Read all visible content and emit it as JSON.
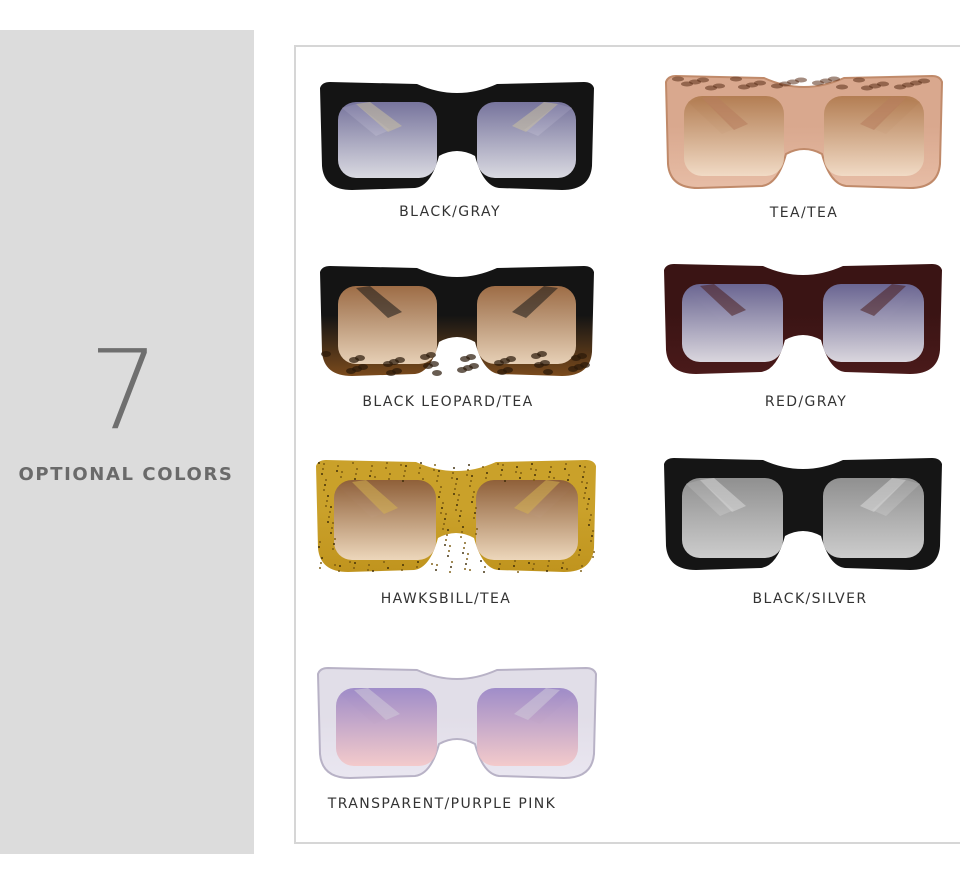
{
  "panel": {
    "count": "7",
    "subtitle": "OPTIONAL COLORS"
  },
  "products": [
    {
      "label": "BLACK/GRAY",
      "frame": "#141414",
      "frame_bottom": "#141414",
      "lens_top": "#7f7ca8",
      "lens_bottom": "#eaeaf2",
      "temple": "#c8c0a0",
      "pattern": "none"
    },
    {
      "label": "TEA/TEA",
      "frame": "#d9a88e",
      "frame_bottom": "#e7bda6",
      "lens_top": "#b07a4e",
      "lens_bottom": "#f2ddc8",
      "temple": "#b77c5c",
      "pattern": "tortoise-top"
    },
    {
      "label": "BLACK LEOPARD/TEA",
      "frame": "#141414",
      "frame_bottom": "#7a4a1c",
      "lens_top": "#a9744a",
      "lens_bottom": "#f1dcc3",
      "temple": "#161616",
      "pattern": "leopard-bottom"
    },
    {
      "label": "RED/GRAY",
      "frame": "#3a1414",
      "frame_bottom": "#4a1a1a",
      "lens_top": "#6e6c9c",
      "lens_bottom": "#e6e6ee",
      "temple": "#4a1e1e",
      "pattern": "none"
    },
    {
      "label": "HAWKSBILL/TEA",
      "frame": "#caa12a",
      "frame_bottom": "#c0941e",
      "lens_top": "#8a5a3a",
      "lens_bottom": "#f0dcc8",
      "temple": "#d4b050",
      "pattern": "glitter"
    },
    {
      "label": "BLACK/SILVER",
      "frame": "#151515",
      "frame_bottom": "#151515",
      "lens_top": "#9a9a9a",
      "lens_bottom": "#dcdcdc",
      "temple": "#d8d8d8",
      "pattern": "none"
    },
    {
      "label": "TRANSPARENT/PURPLE PINK",
      "frame": "#dcd8e4",
      "frame_bottom": "#e6e2ee",
      "lens_top": "#9a86c6",
      "lens_bottom": "#f4c8c8",
      "temple": "#cfcad8",
      "pattern": "clear"
    }
  ]
}
